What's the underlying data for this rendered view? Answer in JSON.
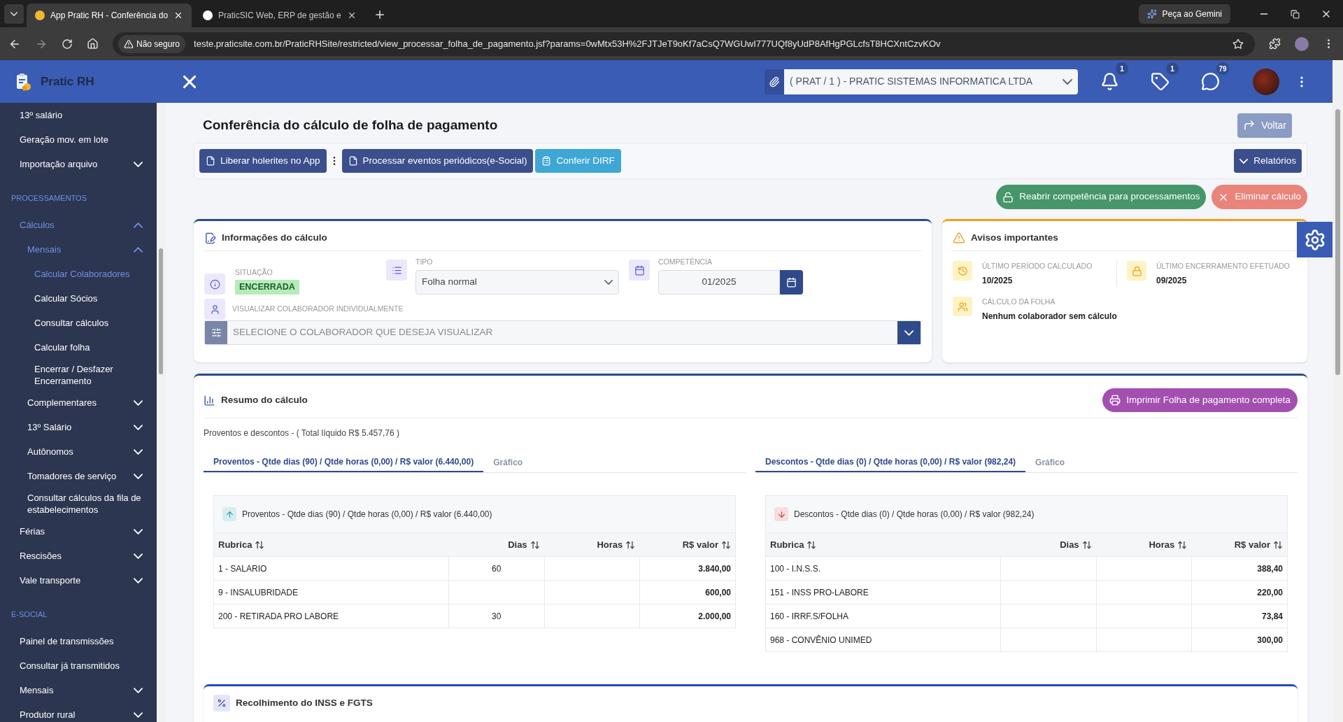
{
  "browser": {
    "tabs": [
      {
        "title": "App Pratic RH - Conferência do",
        "selected": true
      },
      {
        "title": "PraticSIC Web, ERP de gestão e",
        "selected": false
      }
    ],
    "gemini_button": "Peça ao Gemini",
    "security": "Não seguro",
    "url": "teste.praticsite.com.br/PraticRHSite/restricted/view_processar_folha_de_pagamento.jsf?params=0wMtx53H%2FJTJeT9oKf7aCsQ7WGUwI777UQf8yUdP8AfHgPGLcfsT8HCXntCzvKOv"
  },
  "app": {
    "brand": "Pratic RH",
    "company": "( PRAT / 1 ) - PRATIC SISTEMAS INFORMATICA LTDA",
    "header_icons": [
      {
        "kind": "bell",
        "count": "1"
      },
      {
        "kind": "tag",
        "count": "1"
      },
      {
        "kind": "chat",
        "count": "79"
      }
    ]
  },
  "sidebar": {
    "items": [
      {
        "kind": "link",
        "label": "13º salário",
        "selected": false
      },
      {
        "kind": "link",
        "label": "Geração mov. em lote",
        "selected": false
      },
      {
        "kind": "link",
        "label": "Importação arquivo",
        "expanded": false
      },
      {
        "kind": "section",
        "label": "PROCESSAMENTOS"
      },
      {
        "kind": "link",
        "label": "Cálculos",
        "expanded": true,
        "children": [
          {
            "kind": "link",
            "label": "Mensais",
            "expanded": true,
            "children": [
              {
                "kind": "link",
                "label": "Calcular Colaboradores",
                "selected": true
              },
              {
                "kind": "link",
                "label": "Calcular Sócios",
                "selected": false
              },
              {
                "kind": "link",
                "label": "Consultar cálculos",
                "selected": false
              },
              {
                "kind": "link",
                "label": "Calcular folha",
                "selected": false
              },
              {
                "kind": "link",
                "label": "Encerrar / Desfazer Encerramento",
                "selected": false
              }
            ]
          },
          {
            "kind": "link",
            "label": "Complementares",
            "expanded": false
          },
          {
            "kind": "link",
            "label": "13º Salário",
            "expanded": false
          },
          {
            "kind": "link",
            "label": "Autônomos",
            "expanded": false
          },
          {
            "kind": "link",
            "label": "Tomadores de serviço",
            "expanded": false
          },
          {
            "kind": "link",
            "label": "Consultar cálculos da fila de estabelecimentos",
            "selected": false
          }
        ]
      },
      {
        "kind": "link",
        "label": "Férias",
        "expanded": false
      },
      {
        "kind": "link",
        "label": "Rescisões",
        "expanded": false
      },
      {
        "kind": "link",
        "label": "Vale transporte",
        "expanded": false
      },
      {
        "kind": "section",
        "label": "E-SOCIAL"
      },
      {
        "kind": "link",
        "label": "Painel de transmissões",
        "selected": false
      },
      {
        "kind": "link",
        "label": "Consultar já transmitidos",
        "selected": false
      },
      {
        "kind": "link",
        "label": "Mensais",
        "expanded": false
      },
      {
        "kind": "link",
        "label": "Produtor rural",
        "expanded": false
      }
    ]
  },
  "page": {
    "title": "Conferência do cálculo de folha de pagamento",
    "back_button": "Voltar",
    "toolbar": [
      {
        "label": "Liberar holerites no App",
        "kind": "primary"
      },
      {
        "label": "Processar eventos periódicos(e-Social)",
        "kind": "primary"
      },
      {
        "label": "Conferir DIRF",
        "kind": "info"
      }
    ],
    "reports_button": "Relatórios",
    "actions": [
      {
        "label": "Reabrir competência para processamentos",
        "kind": "success"
      },
      {
        "label": "Eliminar cálculo",
        "kind": "danger"
      }
    ]
  },
  "info_card": {
    "title": "Informações do cálculo",
    "situation": {
      "label": "SITUAÇÃO",
      "value": "ENCERRADA"
    },
    "type": {
      "label": "TIPO",
      "value": "Folha normal"
    },
    "period": {
      "label": "COMPETÊNCIA",
      "value": "01/2025"
    },
    "employee": {
      "label": "VISUALIZAR COLABORADOR INDIVIDUALMENTE",
      "placeholder": "SELECIONE O COLABORADOR QUE DESEJA VISUALIZAR"
    }
  },
  "notices": {
    "title": "Avisos importantes",
    "items": [
      {
        "kind": "history",
        "label": "ÚLTIMO PERÍODO CALCULADO",
        "value": "10/2025"
      },
      {
        "kind": "lock",
        "label": "ÚLTIMO ENCERRAMENTO EFETUADO",
        "value": "09/2025"
      },
      {
        "kind": "users",
        "label": "CÁLCULO DA FOLHA",
        "value": "Nenhum colaborador sem cálculo"
      }
    ]
  },
  "summary": {
    "title": "Resumo do cálculo",
    "print_button": "Imprimir Folha de pagamento completa",
    "total": "Proventos e descontos - ( Total líquido R$ 5.457,76 )",
    "panels": [
      {
        "kind": "up",
        "tabs": [
          {
            "label": "Proventos - Qtde dias (90) / Qtde horas (0,00) / R$ valor (6.440,00)",
            "selected": true
          },
          {
            "label": "Gráfico",
            "selected": false
          }
        ],
        "table_title": "Proventos - Qtde dias (90) / Qtde horas (0,00) / R$ valor (6.440,00)",
        "columns": [
          "Rubrica",
          "Dias",
          "Horas",
          "R$ valor"
        ],
        "rows": [
          {
            "rubrica": "1 - SALARIO",
            "dias": "60",
            "valor": "3.840,00"
          },
          {
            "rubrica": "9 - INSALUBRIDADE",
            "valor": "600,00"
          },
          {
            "rubrica": "200 - RETIRADA PRO LABORE",
            "dias": "30",
            "valor": "2.000,00"
          }
        ]
      },
      {
        "kind": "down",
        "tabs": [
          {
            "label": "Descontos - Qtde dias (0) / Qtde horas (0,00) / R$ valor (982,24)",
            "selected": true
          },
          {
            "label": "Gráfico",
            "selected": false
          }
        ],
        "table_title": "Descontos - Qtde dias (0) / Qtde horas (0,00) / R$ valor (982,24)",
        "columns": [
          "Rubrica",
          "Dias",
          "Horas",
          "R$ valor"
        ],
        "rows": [
          {
            "rubrica": "100 - I.N.S.S.",
            "valor": "388,40"
          },
          {
            "rubrica": "151 - INSS PRO-LABORE",
            "valor": "220,00"
          },
          {
            "rubrica": "160 - IRRF.S/FOLHA",
            "valor": "73,84"
          },
          {
            "rubrica": "968 - CONVÊNIO UNIMED",
            "valor": "300,00"
          }
        ]
      }
    ]
  },
  "inss_card": {
    "title": "Recolhimento do INSS e FGTS"
  }
}
